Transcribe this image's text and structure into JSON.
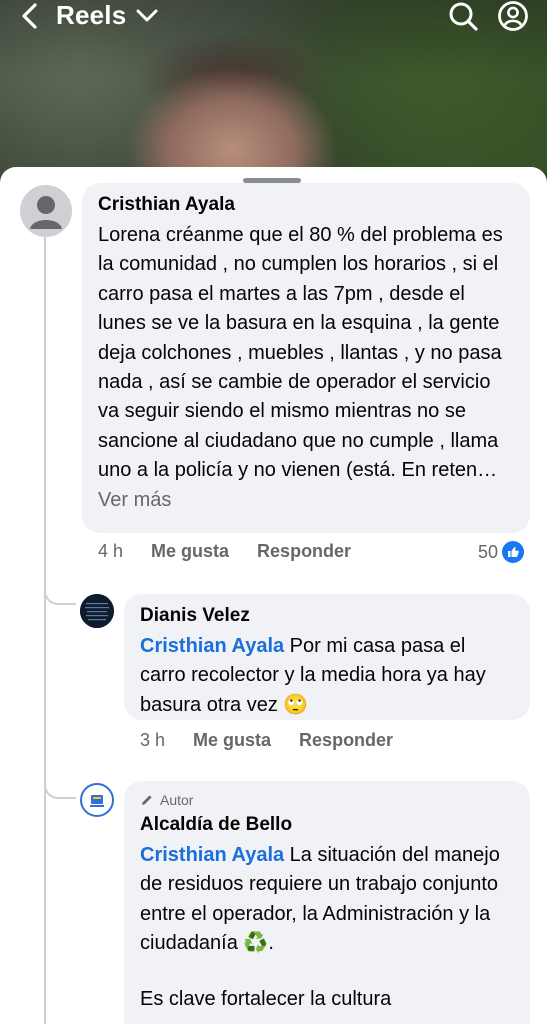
{
  "header": {
    "title": "Reels",
    "icons": [
      "back-arrow-icon",
      "chevron-down-icon",
      "search-icon",
      "profile-icon"
    ]
  },
  "comments": [
    {
      "author": "Cristhian Ayala",
      "text": "Lorena créanme que el 80 % del problema es la comunidad , no cumplen los horarios , si el carro pasa el martes a las 7pm , desde el lunes se ve la basura en la esquina , la gente deja colchones , muebles , llantas , y no pasa nada , así se cambie de operador el servicio va seguir siendo el mismo mientras no se sancione al ciudadano que no cumple , llama uno a la policía y no vienen (está. En reten…",
      "see_more": "Ver más",
      "time": "4 h",
      "like_label": "Me gusta",
      "reply_label": "Responder",
      "reaction_count": "50"
    }
  ],
  "replies": [
    {
      "author": "Dianis Velez",
      "mention": "Cristhian Ayala",
      "text": " Por mi casa pasa el carro recolector y la media hora ya hay basura otra vez 🙄",
      "time": "3 h",
      "like_label": "Me gusta",
      "reply_label": "Responder"
    },
    {
      "badge": "Autor",
      "author": "Alcaldía de Bello",
      "mention": "Cristhian Ayala",
      "text": " La situación del manejo de residuos requiere un trabajo conjunto entre el operador, la Administración y la ciudadanía ♻️.",
      "text2": "Es clave fortalecer la cultura"
    }
  ],
  "colors": {
    "accent": "#1b6fd9",
    "bubble": "#f0f2f5",
    "secondary_text": "#65676b"
  }
}
